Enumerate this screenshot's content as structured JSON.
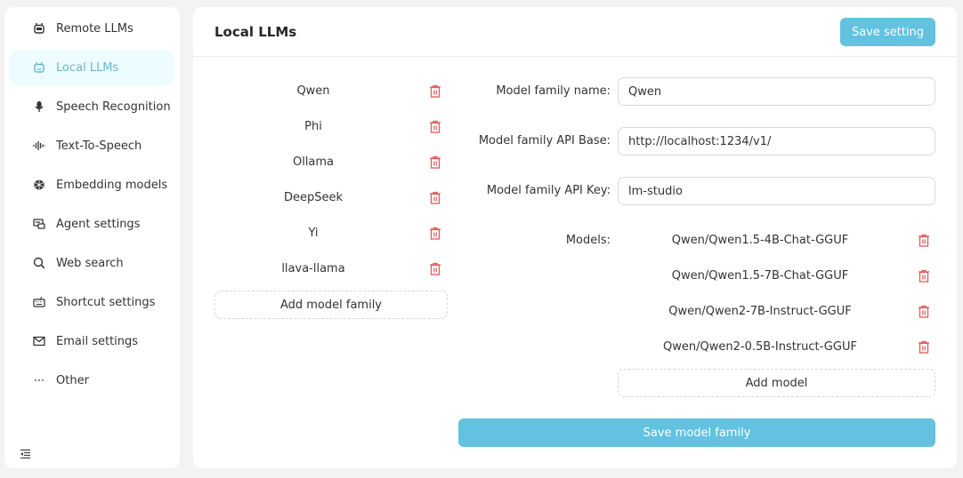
{
  "sidebar": {
    "items": [
      {
        "label": "Remote LLMs",
        "icon": "robot-icon",
        "active": false
      },
      {
        "label": "Local LLMs",
        "icon": "robot-icon",
        "active": true
      },
      {
        "label": "Speech Recognition",
        "icon": "microphone-icon",
        "active": false
      },
      {
        "label": "Text-To-Speech",
        "icon": "sound-wave-icon",
        "active": false
      },
      {
        "label": "Embedding models",
        "icon": "embedding-icon",
        "active": false
      },
      {
        "label": "Agent settings",
        "icon": "agent-icon",
        "active": false
      },
      {
        "label": "Web search",
        "icon": "search-icon",
        "active": false
      },
      {
        "label": "Shortcut settings",
        "icon": "keyboard-icon",
        "active": false
      },
      {
        "label": "Email settings",
        "icon": "mail-icon",
        "active": false
      },
      {
        "label": "Other",
        "icon": "ellipsis-icon",
        "active": false
      }
    ],
    "collapse_icon": "menu-fold-icon"
  },
  "header": {
    "title": "Local LLMs",
    "save_label": "Save setting"
  },
  "families": {
    "items": [
      "Qwen",
      "Phi",
      "Ollama",
      "DeepSeek",
      "Yi",
      "llava-llama"
    ],
    "add_label": "Add model family"
  },
  "form": {
    "name_label": "Model family name:",
    "name_value": "Qwen",
    "api_base_label": "Model family API Base:",
    "api_base_value": "http://localhost:1234/v1/",
    "api_key_label": "Model family API Key:",
    "api_key_value": "lm-studio",
    "models_label": "Models:",
    "models": [
      "Qwen/Qwen1.5-4B-Chat-GGUF",
      "Qwen/Qwen1.5-7B-Chat-GGUF",
      "Qwen/Qwen2-7B-Instruct-GGUF",
      "Qwen/Qwen2-0.5B-Instruct-GGUF"
    ],
    "add_model_label": "Add model",
    "save_family_label": "Save model family"
  },
  "colors": {
    "accent": "#62c2df",
    "active_bg": "#ecfcff",
    "active_text": "#69b5d2",
    "danger": "#e05a5a"
  }
}
